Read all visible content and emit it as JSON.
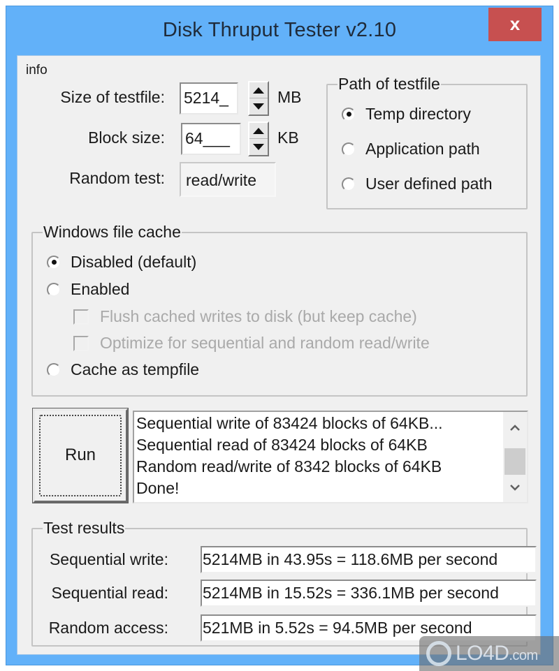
{
  "window": {
    "title": "Disk Thruput Tester v2.10",
    "close_label": "x",
    "frame_color": "#62b1f9",
    "close_color": "#c75050"
  },
  "info": {
    "label": "info",
    "testfile_size": {
      "label": "Size of testfile:",
      "value": "5214_",
      "unit": "MB"
    },
    "block_size": {
      "label": "Block size:",
      "value": "64___",
      "unit": "KB"
    },
    "random_test": {
      "label": "Random test:",
      "value": "read/write"
    }
  },
  "path_group": {
    "title": "Path of testfile",
    "options": [
      {
        "label": "Temp directory",
        "selected": true
      },
      {
        "label": "Application path",
        "selected": false
      },
      {
        "label": "User defined path",
        "selected": false
      }
    ]
  },
  "cache_group": {
    "title": "Windows file cache",
    "options": [
      {
        "label": "Disabled (default)",
        "selected": true
      },
      {
        "label": "Enabled",
        "selected": false
      },
      {
        "label": "Cache as tempfile",
        "selected": false
      }
    ],
    "sub_options": [
      {
        "label": "Flush cached writes to disk (but keep cache)",
        "checked": false,
        "enabled": false
      },
      {
        "label": "Optimize for sequential and random read/write",
        "checked": false,
        "enabled": false
      }
    ]
  },
  "run_button": {
    "label": "Run"
  },
  "log": {
    "lines": [
      "Sequential write of 83424 blocks of 64KB...",
      "Sequential read of 83424 blocks of 64KB",
      "Random read/write of 8342 blocks of 64KB",
      "Done!"
    ],
    "scroll_up": "^",
    "scroll_down": "v"
  },
  "results": {
    "title": "Test results",
    "rows": [
      {
        "label": "Sequential write:",
        "value": "5214MB in 43.95s = 118.6MB per second"
      },
      {
        "label": "Sequential read:",
        "value": "5214MB in 15.52s = 336.1MB per second"
      },
      {
        "label": "Random access:",
        "value": "521MB in 5.52s = 94.5MB per second"
      }
    ]
  },
  "watermark": {
    "brand": "LO4D",
    "suffix": ".com"
  }
}
